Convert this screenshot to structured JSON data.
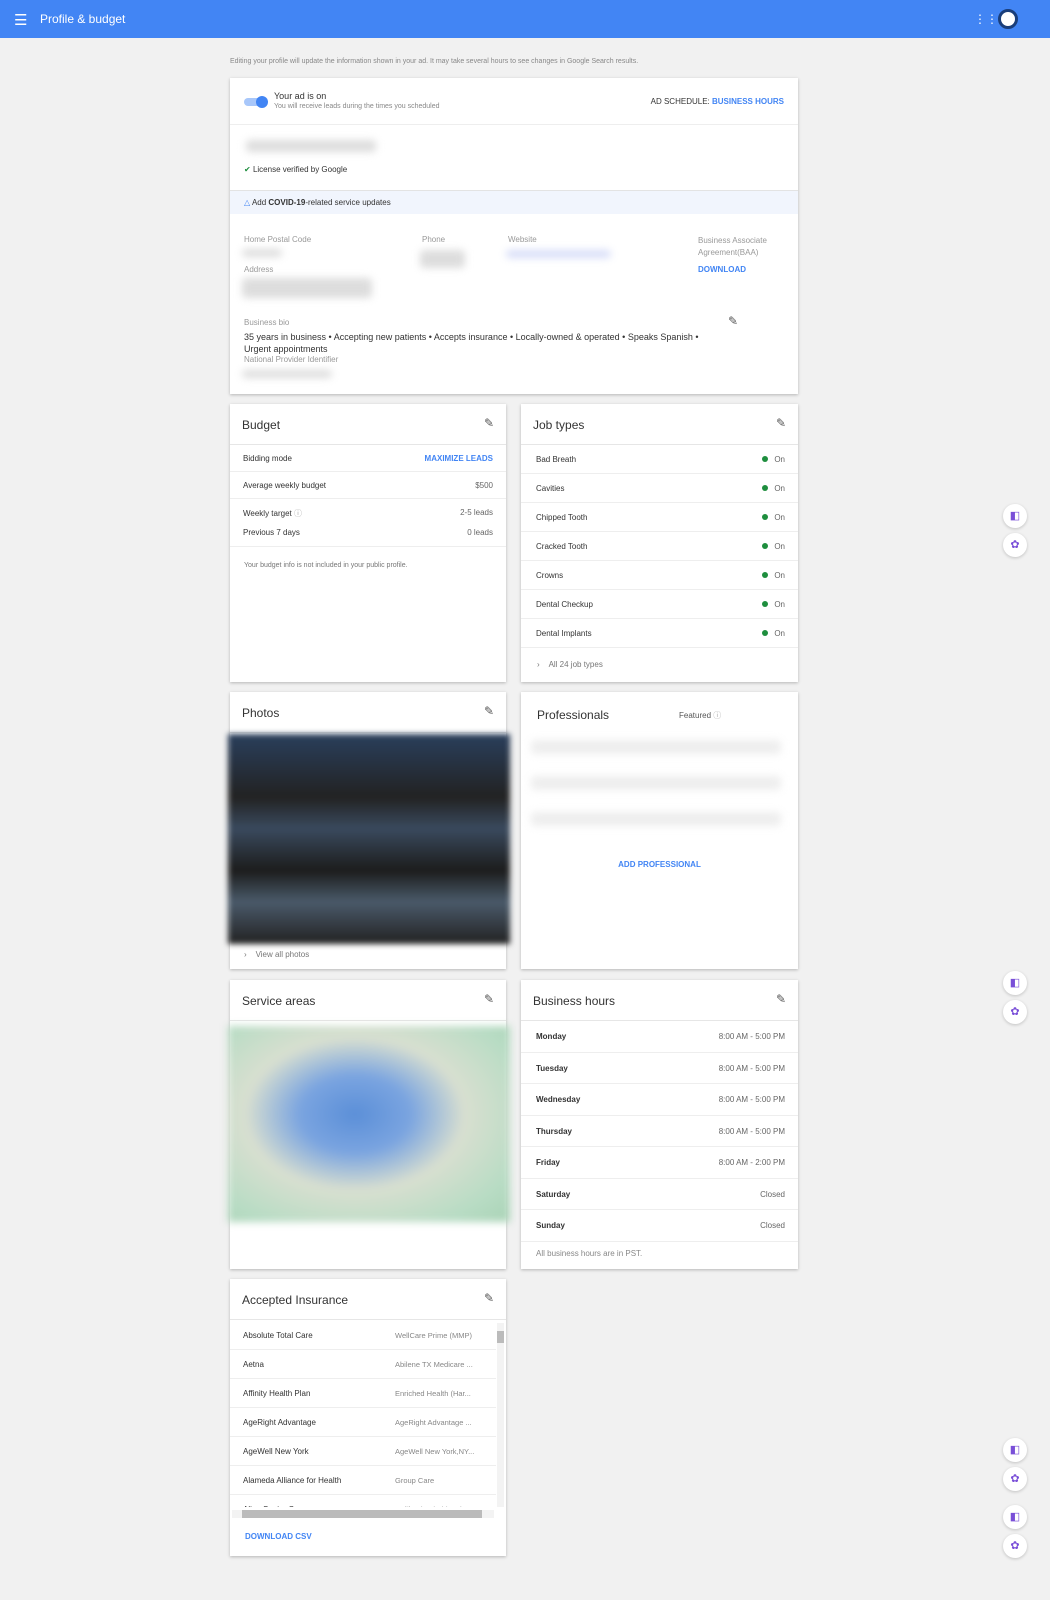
{
  "header": {
    "title": "Profile & budget",
    "menu_icon": "hamburger-icon",
    "apps_icon": "apps-grid-icon"
  },
  "notice": "Editing your profile will update the information shown in your ad. It may take several hours to see changes in Google Search results.",
  "profile": {
    "ad_status": "Your ad is on",
    "ad_sub": "You will receive leads during the times you scheduled",
    "ad_schedule_label": "AD SCHEDULE:",
    "ad_schedule_value": "BUSINESS HOURS",
    "license": "License verified by Google",
    "covid_prefix": "Add ",
    "covid_bold": "COVID-19",
    "covid_suffix": "-related service updates",
    "postal_label": "Home Postal Code",
    "address_label": "Address",
    "phone_label": "Phone",
    "website_label": "Website",
    "baa_label": "Business Associate Agreement(BAA)",
    "baa_download": "DOWNLOAD",
    "bio_label": "Business bio",
    "bio": "35 years in business • Accepting new patients • Accepts insurance • Locally-owned & operated • Speaks Spanish • Urgent appointments",
    "npi_label": "National Provider Identifier"
  },
  "budget": {
    "title": "Budget",
    "rows": [
      {
        "label": "Bidding mode",
        "value": "MAXIMIZE LEADS"
      },
      {
        "label": "Average weekly budget",
        "value": "$500"
      },
      {
        "label": "Weekly target",
        "value": "2-5 leads"
      },
      {
        "label": "Previous 7 days",
        "value": "0 leads"
      }
    ],
    "note": "Your budget info is not included in your public profile."
  },
  "job_types": {
    "title": "Job types",
    "items": [
      {
        "name": "Bad Breath",
        "status": "On"
      },
      {
        "name": "Cavities",
        "status": "On"
      },
      {
        "name": "Chipped Tooth",
        "status": "On"
      },
      {
        "name": "Cracked Tooth",
        "status": "On"
      },
      {
        "name": "Crowns",
        "status": "On"
      },
      {
        "name": "Dental Checkup",
        "status": "On"
      },
      {
        "name": "Dental Implants",
        "status": "On"
      }
    ],
    "all": "All 24 job types"
  },
  "photos": {
    "title": "Photos",
    "view_all": "View all photos"
  },
  "professionals": {
    "title": "Professionals",
    "featured": "Featured",
    "add": "ADD PROFESSIONAL"
  },
  "service_areas": {
    "title": "Service areas"
  },
  "hours": {
    "title": "Business hours",
    "days": [
      {
        "day": "Monday",
        "hours": "8:00 AM - 5:00 PM"
      },
      {
        "day": "Tuesday",
        "hours": "8:00 AM - 5:00 PM"
      },
      {
        "day": "Wednesday",
        "hours": "8:00 AM - 5:00 PM"
      },
      {
        "day": "Thursday",
        "hours": "8:00 AM - 5:00 PM"
      },
      {
        "day": "Friday",
        "hours": "8:00 AM - 2:00 PM"
      },
      {
        "day": "Saturday",
        "hours": "Closed"
      },
      {
        "day": "Sunday",
        "hours": "Closed"
      }
    ],
    "note": "All business hours are in PST."
  },
  "insurance": {
    "title": "Accepted Insurance",
    "rows": [
      {
        "name": "Absolute Total Care",
        "plan": "WellCare Prime (MMP)"
      },
      {
        "name": "Aetna",
        "plan": "Abilene TX Medicare ..."
      },
      {
        "name": "Affinity Health Plan",
        "plan": "Enriched Health (Har..."
      },
      {
        "name": "AgeRight Advantage",
        "plan": "AgeRight Advantage ..."
      },
      {
        "name": "AgeWell New York",
        "plan": "AgeWell New York,NY..."
      },
      {
        "name": "Alameda Alliance for Health",
        "plan": "Group Care"
      },
      {
        "name": "Align Senior Care",
        "plan": "California Florida Mic..."
      }
    ],
    "download": "DOWNLOAD CSV"
  },
  "colors": {
    "brand": "#4285f4",
    "on": "#1e8e3e"
  }
}
